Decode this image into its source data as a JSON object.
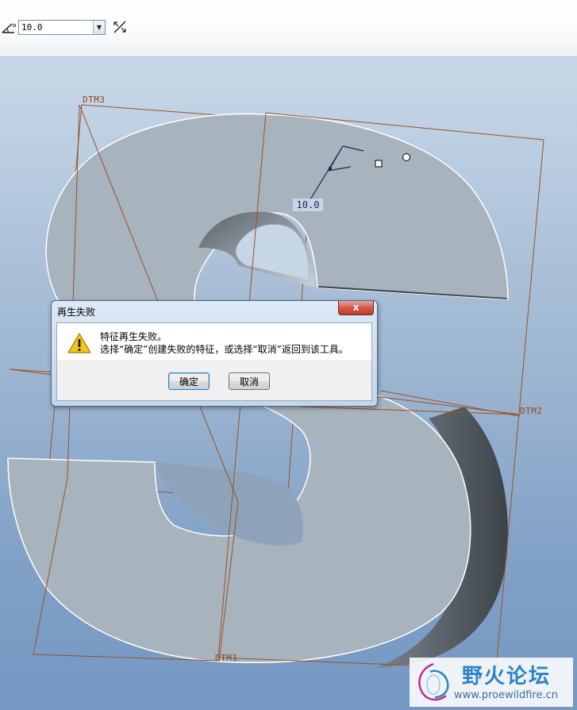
{
  "toolbar": {
    "angle_value": "10.0",
    "icons": [
      "angle-icon",
      "chevron-down-icon",
      "flip-direction-icon"
    ]
  },
  "viewport": {
    "datums": {
      "dtm1": "DTM1",
      "dtm2": "DTM2",
      "dtm3": "DTM3"
    },
    "dimension_value": "10.0",
    "colors": {
      "datum": "#9a5324",
      "model_face": "#a7b3bd",
      "model_shadow": "#4a5157"
    }
  },
  "dialog": {
    "title": "再生失败",
    "close_label": "x",
    "message_line1": "特征再生失败。",
    "message_line2": "选择“确定”创建失败的特征，或选择“取消”返回到该工具。",
    "ok_label": "确定",
    "cancel_label": "取消",
    "icons": [
      "warning-icon",
      "close-icon"
    ]
  },
  "watermark": {
    "title": "野火论坛",
    "url": "www.proewildfire.cn"
  }
}
